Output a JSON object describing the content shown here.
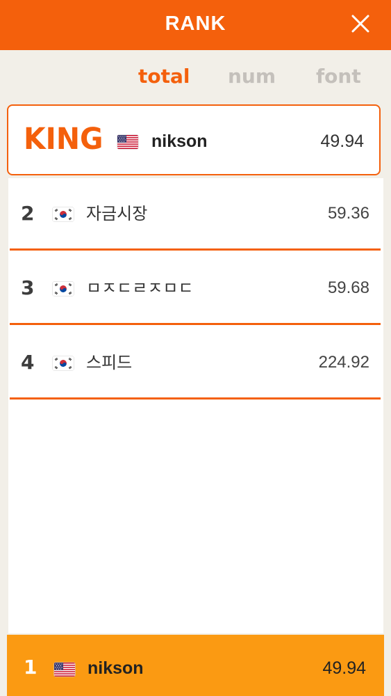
{
  "header": {
    "title": "RANK"
  },
  "tabs": [
    {
      "label": "total",
      "active": true
    },
    {
      "label": "num",
      "active": false
    },
    {
      "label": "font",
      "active": false
    }
  ],
  "king": {
    "badge": "KING",
    "flag": "us-flag-icon",
    "name": "nikson",
    "score": "49.94"
  },
  "rows": [
    {
      "rank": "2",
      "flag": "kr-flag-icon",
      "name": "자금시장",
      "score": "59.36"
    },
    {
      "rank": "3",
      "flag": "kr-flag-icon",
      "name": "ㅁㅈㄷㄹㅈㅁㄷ",
      "score": "59.68"
    },
    {
      "rank": "4",
      "flag": "kr-flag-icon",
      "name": "스피드",
      "score": "224.92"
    }
  ],
  "my_rank": {
    "rank": "1",
    "flag": "us-flag-icon",
    "name": "nikson",
    "score": "49.94"
  },
  "colors": {
    "accent": "#f4600c",
    "my_rank_bg": "#fb9a12",
    "background": "#f2efe8"
  }
}
